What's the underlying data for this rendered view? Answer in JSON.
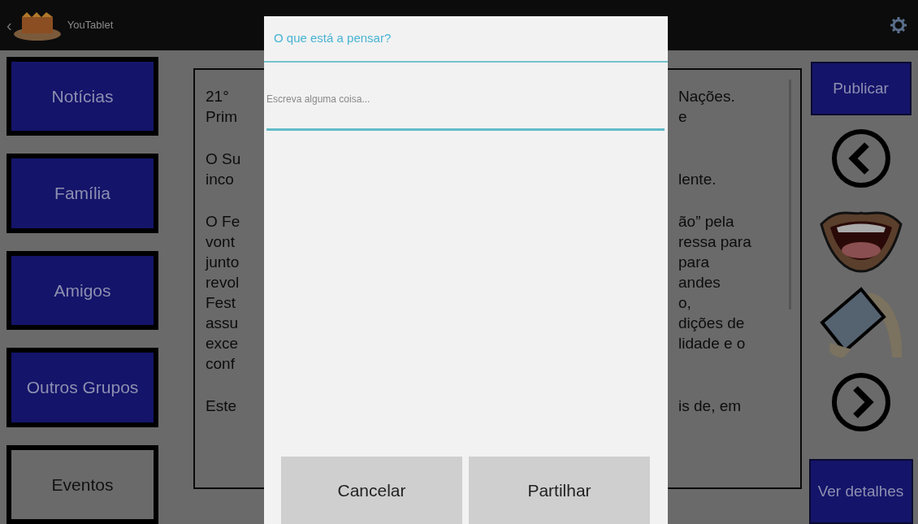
{
  "app_bar": {
    "back": "‹",
    "title": "YouTablet"
  },
  "nav_buttons": [
    {
      "label": "Notícias",
      "selected": true
    },
    {
      "label": "Família",
      "selected": true
    },
    {
      "label": "Amigos",
      "selected": true
    },
    {
      "label": "Outros Grupos",
      "selected": true
    },
    {
      "label": "Eventos",
      "selected": false
    }
  ],
  "article": {
    "paragraphs": [
      {
        "lines": [
          {
            "left": "21°",
            "right": "Nações."
          },
          {
            "left": "Prim",
            "right": "e"
          }
        ]
      },
      {
        "lines": [
          {
            "left": "O Su"
          },
          {
            "left": "inco",
            "right": "lente."
          }
        ]
      },
      {
        "lines": [
          {
            "left": "O Fe",
            "right": "ão” pela"
          },
          {
            "left": "vont",
            "right": "ressa para"
          },
          {
            "left": "junto",
            "right": "para"
          },
          {
            "left": "revol",
            "right": "andes"
          },
          {
            "left": "Fest",
            "right": "o,"
          },
          {
            "left": "assu",
            "right": "dições de"
          },
          {
            "left": "exce",
            "right": "lidade e o"
          },
          {
            "left": "conf"
          }
        ]
      },
      {
        "lines": [
          {
            "left": "Este",
            "right": "is de, em"
          }
        ]
      }
    ]
  },
  "side_actions": [
    {
      "kind": "button",
      "label": "Publicar"
    },
    {
      "kind": "prev"
    },
    {
      "kind": "speak"
    },
    {
      "kind": "tablet"
    },
    {
      "kind": "next"
    },
    {
      "kind": "button",
      "label": "Ver detalhes"
    }
  ],
  "dialog": {
    "title": "O que está a pensar?",
    "field": {
      "placeholder": "Escreva alguma coisa..."
    },
    "buttons": [
      "Cancelar",
      "Partilhar"
    ]
  }
}
